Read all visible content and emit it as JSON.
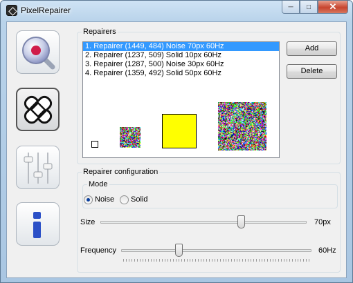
{
  "window": {
    "title": "PixelRepairer"
  },
  "nav": [
    {
      "name": "finder",
      "icon": "magnifier-icon"
    },
    {
      "name": "repairer",
      "icon": "bandage-icon"
    },
    {
      "name": "settings",
      "icon": "sliders-icon"
    },
    {
      "name": "info",
      "icon": "info-icon"
    }
  ],
  "repairers": {
    "title": "Repairers",
    "items": [
      "1. Repairer (1449, 484) Noise 70px 60Hz",
      "2. Repairer (1237, 509) Solid 10px 60Hz",
      "3. Repairer (1287, 500) Noise 30px 60Hz",
      "4. Repairer (1359, 492) Solid 50px 60Hz"
    ],
    "selected_index": 0,
    "add_label": "Add",
    "delete_label": "Delete",
    "preview_colors": {
      "solid_yellow": "#ffff00"
    }
  },
  "config": {
    "title": "Repairer configuration",
    "mode_title": "Mode",
    "mode_noise": "Noise",
    "mode_solid": "Solid",
    "mode_selected": "Noise",
    "size_label": "Size",
    "size_value": "70px",
    "size_fraction": 0.68,
    "frequency_label": "Frequency",
    "frequency_value": "60Hz",
    "frequency_fraction": 0.3
  }
}
